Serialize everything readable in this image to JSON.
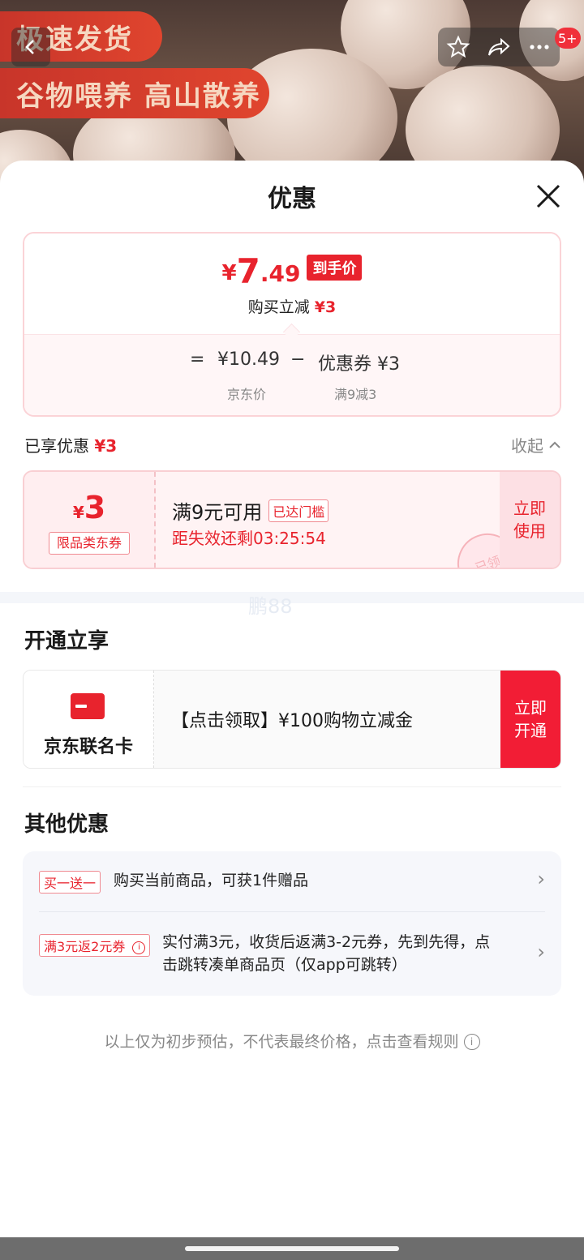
{
  "hero": {
    "banner1": "极速发货",
    "banner2": "谷物喂养 高山散养",
    "badge": "5+",
    "icons": [
      "back-icon",
      "star-icon",
      "share-icon",
      "more-icon"
    ]
  },
  "sheet": {
    "title": "优惠"
  },
  "price": {
    "currency": "¥",
    "final_int": "7",
    "final_dec": ".49",
    "final_tag": "到手价",
    "reduce_label": "购买立减",
    "reduce_value": "¥3",
    "eq": "=",
    "base_price": "¥10.49",
    "minus": "−",
    "coupon_label": "优惠券",
    "coupon_value": "¥3",
    "base_caption": "京东价",
    "coupon_caption": "满9减3"
  },
  "enjoyed": {
    "label": "已享优惠",
    "value": "¥3",
    "collapse": "收起"
  },
  "coupon": {
    "currency": "¥",
    "amount": "3",
    "type": "限品类东券",
    "condition": "满9元可用",
    "reached_tag": "已达门槛",
    "timer": "距失效还剩03:25:54",
    "btn_line1": "立即",
    "btn_line2": "使用",
    "stamp": "已领"
  },
  "watermark": "鹏88",
  "open_section": {
    "title": "开通立享",
    "card_name": "京东联名卡",
    "card_text": "【点击领取】¥100购物立减金",
    "btn_line1": "立即",
    "btn_line2": "开通"
  },
  "other_section": {
    "title": "其他优惠",
    "rows": [
      {
        "tag": "买一送一",
        "text": "购买当前商品，可获1件赠品"
      },
      {
        "tag": "满3元返2元券",
        "text_line1": "实付满3元，收货后返满3-2元券，先到先得，点",
        "text_line2": "击跳转凑单商品页（仅app可跳转）"
      }
    ]
  },
  "footer": {
    "note": "以上仅为初步预估，不代表最终价格，点击查看规则"
  },
  "colors": {
    "accent": "#e8232d",
    "accent_bright": "#f21d35"
  }
}
